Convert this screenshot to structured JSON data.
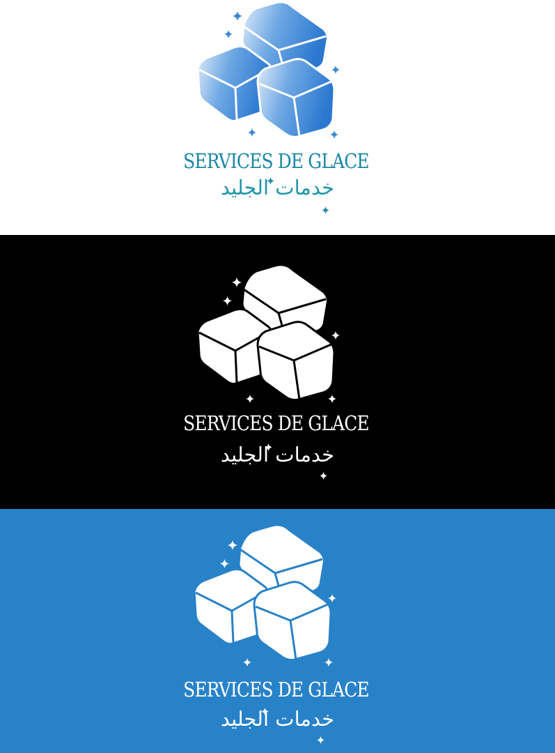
{
  "brand": {
    "name": "SERVICES DE GLACE",
    "arabic": "خدمات الجليد"
  },
  "logo": {
    "icon": "ice-cubes-icon",
    "sparkle_icon": "sparkle-icon"
  },
  "variants": [
    {
      "background": "#ffffff",
      "cube_fill": "gradient #d6e8f8 to #2e7fd4",
      "cube_stroke": "#ffffff",
      "name_color": "#1a86a6",
      "arabic_color": "#1f96a8"
    },
    {
      "background": "#000000",
      "cube_fill": "#ffffff",
      "cube_stroke": "#000000",
      "name_color": "#ffffff",
      "arabic_color": "#ffffff"
    },
    {
      "background": "#2882c8",
      "cube_fill": "#ffffff",
      "cube_stroke": "#2882c8",
      "name_color": "#ffffff",
      "arabic_color": "#ffffff"
    }
  ]
}
